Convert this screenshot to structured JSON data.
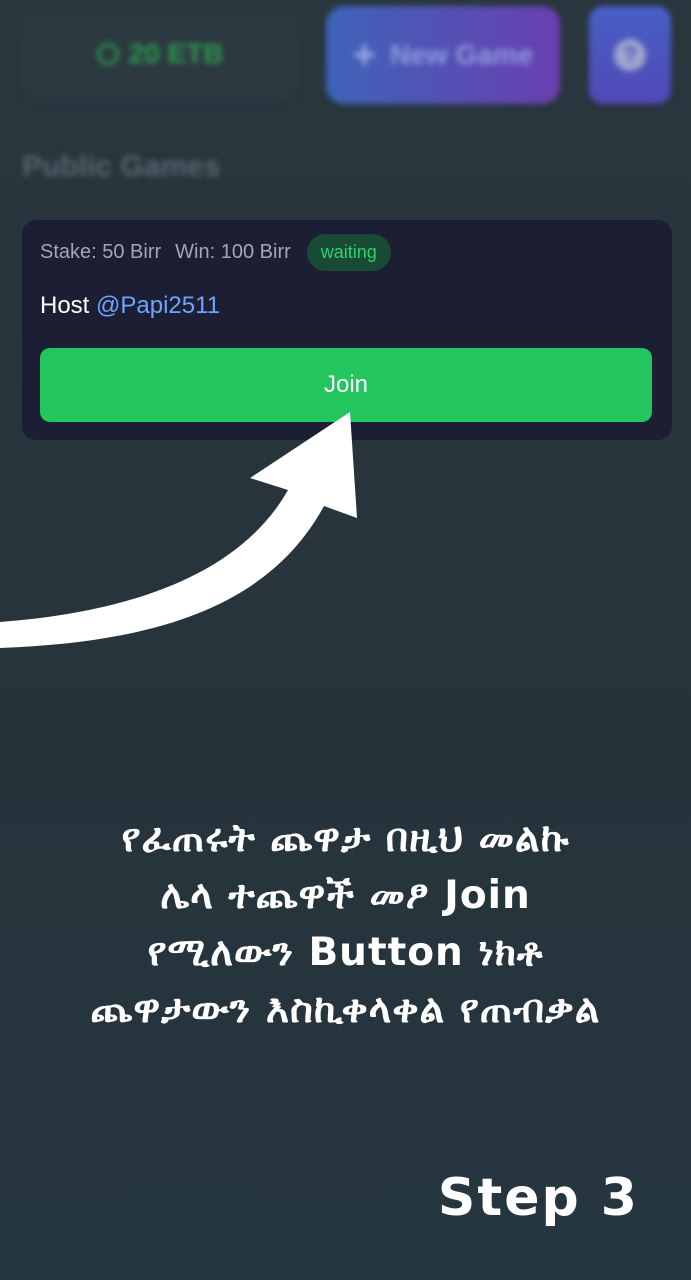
{
  "header": {
    "balance": "20 ETB",
    "new_game_label": "New Game",
    "icons": {
      "balance": "coin-icon",
      "new_game": "plus-icon",
      "help": "question-icon"
    }
  },
  "section_title": "Public Games",
  "game": {
    "stake": "Stake: 50 Birr",
    "win": "Win: 100 Birr",
    "status": "waiting",
    "host_label": "Host",
    "host_user": "@Papi2511",
    "join_label": "Join"
  },
  "caption": {
    "lines": [
      "የፈጠሩት ጨዋታ በዚህ መልኩ",
      "ሌላ ተጨዋች መፆ Join",
      "የሚለውን Button ነክቶ",
      "ጨዋታውን እስኪቀላቀል የጠብቃል"
    ]
  },
  "step_label": "Step 3",
  "colors": {
    "background": "#29363e",
    "card": "#1c1e33",
    "join_button": "#22c55e",
    "status_badge_bg": "#184a36",
    "status_badge_text": "#2fd36b",
    "host_link": "#6ea3ff"
  }
}
